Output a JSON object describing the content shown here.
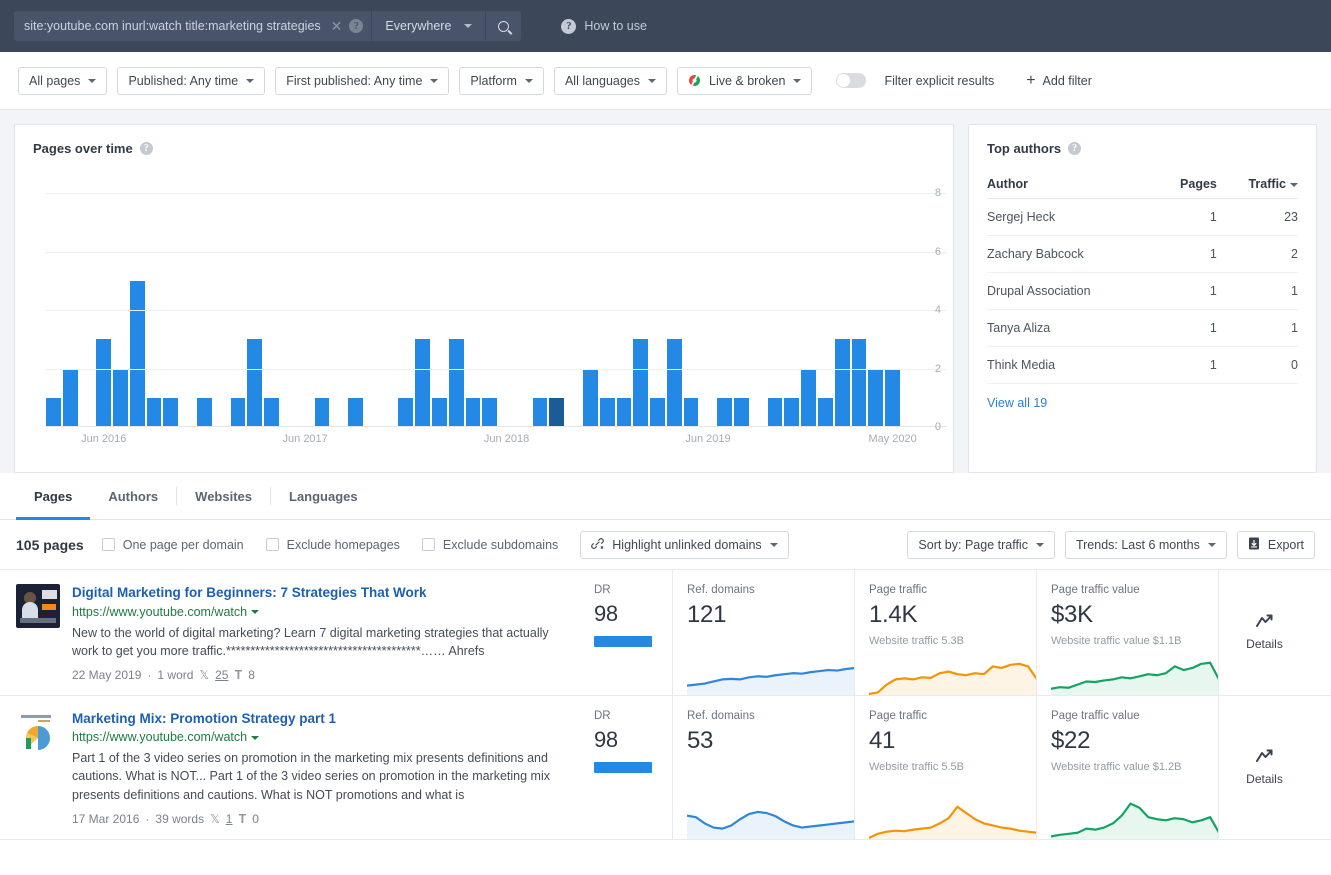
{
  "topbar": {
    "query": "site:youtube.com inurl:watch title:marketing strategies",
    "query_placeholder": "Enter search query",
    "clear_label": "✕",
    "help_label": "?",
    "scope": "Everywhere",
    "search_icon": "search-icon",
    "how_to_use": "How to use"
  },
  "filters": [
    {
      "label": "All pages",
      "caret": true,
      "icon": null
    },
    {
      "label": "Published: Any time",
      "caret": true,
      "icon": null
    },
    {
      "label": "First published: Any time",
      "caret": true,
      "icon": null
    },
    {
      "label": "Platform",
      "caret": true,
      "icon": null
    },
    {
      "label": "All languages",
      "caret": true,
      "icon": null
    },
    {
      "label": "Live & broken",
      "caret": true,
      "icon": "live-broken-icon"
    }
  ],
  "explicit_toggle": {
    "label": "Filter explicit results",
    "on": false
  },
  "add_filter": {
    "label": "Add filter",
    "plus": "+"
  },
  "chart_panel": {
    "title": "Pages over time",
    "tooltip": "?"
  },
  "chart_data": {
    "type": "bar",
    "title": "Pages over time",
    "xlabel": "",
    "ylabel": "",
    "ylim": [
      0,
      8
    ],
    "yticks": [
      0,
      2,
      4,
      6,
      8
    ],
    "grid": true,
    "bar_color": "#2489e4",
    "highlight_color": "#1a5c96",
    "tick_labels": [
      "Jun 2016",
      "Jun 2017",
      "Jun 2018",
      "Jun 2019",
      "May 2020"
    ],
    "tick_indices": [
      3,
      15,
      27,
      39,
      50
    ],
    "values": [
      1,
      2,
      0,
      3,
      2,
      5,
      1,
      1,
      0,
      1,
      0,
      1,
      3,
      1,
      0,
      0,
      1,
      0,
      1,
      0,
      0,
      1,
      3,
      1,
      3,
      1,
      1,
      0,
      0,
      1,
      1,
      0,
      2,
      1,
      1,
      3,
      1,
      3,
      1,
      0,
      1,
      1,
      0,
      1,
      1,
      2,
      1,
      3,
      3,
      2,
      2
    ],
    "highlight_index": 30,
    "highlight_value": 1
  },
  "authors_panel": {
    "title": "Top authors",
    "tooltip": "?",
    "columns": [
      "Author",
      "Pages",
      "Traffic"
    ],
    "sorted_column": "Traffic",
    "rows": [
      {
        "author": "Sergej Heck",
        "pages": "1",
        "traffic": "23"
      },
      {
        "author": "Zachary Babcock",
        "pages": "1",
        "traffic": "2"
      },
      {
        "author": "Drupal Association",
        "pages": "1",
        "traffic": "1"
      },
      {
        "author": "Tanya Aliza",
        "pages": "1",
        "traffic": "1"
      },
      {
        "author": "Think Media",
        "pages": "1",
        "traffic": "0"
      }
    ],
    "view_all": "View all 19"
  },
  "tabs": [
    {
      "label": "Pages",
      "active": true
    },
    {
      "label": "Authors",
      "active": false
    },
    {
      "label": "Websites",
      "active": false
    },
    {
      "label": "Languages",
      "active": false
    }
  ],
  "results_toolbar": {
    "count": "105 pages",
    "checkboxes": [
      {
        "label": "One page per domain",
        "checked": false
      },
      {
        "label": "Exclude homepages",
        "checked": false
      },
      {
        "label": "Exclude subdomains",
        "checked": false
      }
    ],
    "highlight": "Highlight unlinked domains",
    "sort_by": "Sort by: Page traffic",
    "trends": "Trends: Last 6 months",
    "export": "Export"
  },
  "metric_headers": {
    "dr": "DR",
    "ref_domains": "Ref. domains",
    "page_traffic": "Page traffic",
    "page_traffic_value": "Page traffic value",
    "details": "Details"
  },
  "results": [
    {
      "title": "Digital Marketing for Beginners: 7 Strategies That Work",
      "url": "https://www.youtube.com/watch",
      "description": "New to the world of digital marketing? Learn 7 digital marketing strategies that actually work to get you more traffic.****************************************…… Ahrefs",
      "date": "22 May 2019",
      "words": "1 word",
      "twitter": "25",
      "pinterest": "8",
      "dr": "98",
      "ref_domains": "121",
      "page_traffic": "1.4K",
      "website_traffic": "Website traffic 5.3B",
      "page_traffic_value": "$3K",
      "website_traffic_value": "Website traffic value $1.1B",
      "thumb": "dark-video-thumbnail"
    },
    {
      "title": "Marketing Mix: Promotion Strategy part 1",
      "url": "https://www.youtube.com/watch",
      "description": "Part 1 of the 3 video series on promotion in the marketing mix presents definitions and cautions. What is NOT... Part 1 of the 3 video series on promotion in the marketing mix presents definitions and cautions. What is NOT promotions and what is",
      "date": "17 Mar 2016",
      "words": "39 words",
      "twitter": "1",
      "pinterest": "0",
      "dr": "98",
      "ref_domains": "53",
      "page_traffic": "41",
      "website_traffic": "Website traffic 5.5B",
      "page_traffic_value": "$22",
      "website_traffic_value": "Website traffic value $1.2B",
      "thumb": "pie-chart-thumbnail"
    }
  ],
  "colors": {
    "header_bg": "#3c4759",
    "accent_blue": "#2489e4",
    "link_blue": "#1b60b5",
    "url_green": "#1d7d3f",
    "spark_blue": "#2e86d8",
    "spark_orange": "#f59300",
    "spark_green": "#13a463"
  }
}
